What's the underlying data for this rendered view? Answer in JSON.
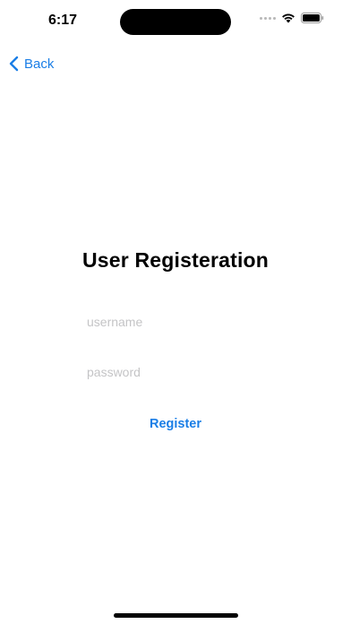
{
  "status_bar": {
    "time": "6:17"
  },
  "nav": {
    "back_label": "Back"
  },
  "main": {
    "title": "User Registeration",
    "username_placeholder": "username",
    "username_value": "",
    "password_placeholder": "password",
    "password_value": "",
    "register_label": "Register"
  },
  "colors": {
    "accent": "#1a7ee6",
    "placeholder": "#c4c4c6"
  },
  "icons": {
    "back": "chevron-left-icon",
    "wifi": "wifi-icon",
    "battery": "battery-icon",
    "signal": "cellular-signal-icon"
  }
}
